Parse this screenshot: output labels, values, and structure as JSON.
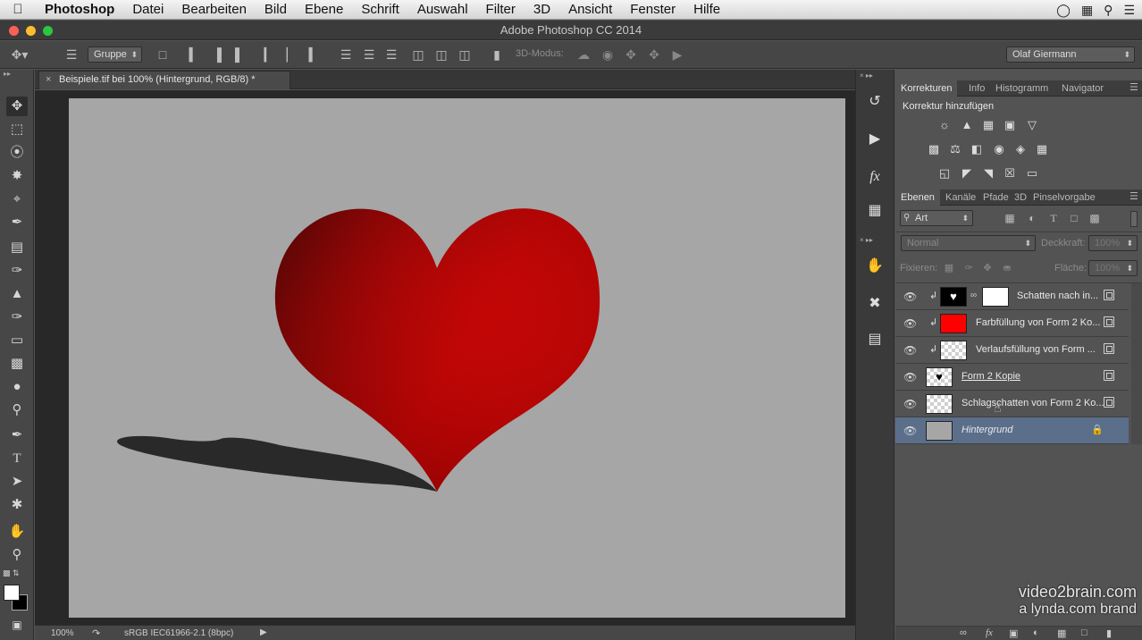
{
  "menubar": {
    "apple": "",
    "app": "Photoshop",
    "items": [
      "Datei",
      "Bearbeiten",
      "Bild",
      "Ebene",
      "Schrift",
      "Auswahl",
      "Filter",
      "3D",
      "Ansicht",
      "Fenster",
      "Hilfe"
    ]
  },
  "window": {
    "title": "Adobe Photoshop CC 2014"
  },
  "options": {
    "auto_select_value": "Gruppe",
    "mode_label": "3D-Modus:",
    "workspace_user": "Olaf Giermann"
  },
  "document": {
    "tab_title": "Beispiele.tif bei 100% (Hintergrund, RGB/8) *",
    "zoom": "100%",
    "color_profile": "sRGB IEC61966-2.1 (8bpc)"
  },
  "adjustments": {
    "tabs": [
      "Korrekturen",
      "Info",
      "Histogramm",
      "Navigator"
    ],
    "heading": "Korrektur hinzufügen"
  },
  "layers": {
    "tabs": [
      "Ebenen",
      "Kanäle",
      "Pfade",
      "3D",
      "Pinselvorgabe"
    ],
    "filter_kind": "Art",
    "blend_mode": "Normal",
    "opacity_label": "Deckkraft:",
    "opacity_value": "100%",
    "lock_label": "Fixieren:",
    "fill_label": "Fläche:",
    "fill_value": "100%",
    "items": [
      {
        "name": "Schatten nach in..."
      },
      {
        "name": "Farbfüllung von Form 2 Ko..."
      },
      {
        "name": "Verlaufsfüllung von Form ..."
      },
      {
        "name": "Form 2 Kopie"
      },
      {
        "name": "Schlagschatten von Form 2 Ko..."
      },
      {
        "name": "Hintergrund"
      }
    ],
    "selected_index": 5
  },
  "watermark": {
    "line1": "video2brain.com",
    "line2": "a lynda.com brand"
  },
  "colors": {
    "heart_red": "#e00000",
    "canvas_gray": "#a6a6a6",
    "selected_layer": "#5b6f8b"
  }
}
